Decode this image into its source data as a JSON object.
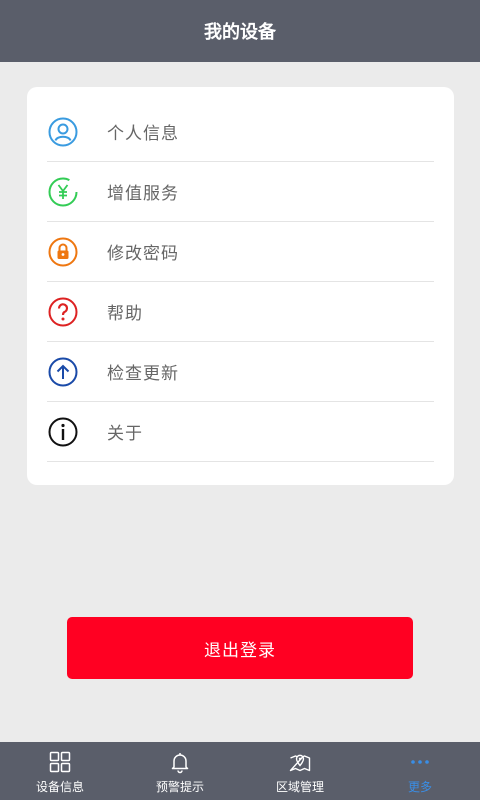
{
  "header": {
    "title": "我的设备"
  },
  "menu": {
    "items": [
      {
        "label": "个人信息",
        "icon": "user-circle-icon",
        "color": "#3a9be0"
      },
      {
        "label": "增值服务",
        "icon": "yen-circle-icon",
        "color": "#33cc55"
      },
      {
        "label": "修改密码",
        "icon": "lock-circle-icon",
        "color": "#ee7711"
      },
      {
        "label": "帮助",
        "icon": "question-circle-icon",
        "color": "#dd2222"
      },
      {
        "label": "检查更新",
        "icon": "arrow-up-circle-icon",
        "color": "#1a4aa8"
      },
      {
        "label": "关于",
        "icon": "info-circle-icon",
        "color": "#111111"
      }
    ]
  },
  "logout": {
    "label": "退出登录"
  },
  "tabbar": {
    "tabs": [
      {
        "label": "设备信息",
        "icon": "grid-icon"
      },
      {
        "label": "预警提示",
        "icon": "bell-icon"
      },
      {
        "label": "区域管理",
        "icon": "map-pin-icon"
      },
      {
        "label": "更多",
        "icon": "more-dots-icon",
        "active": true
      }
    ]
  },
  "colors": {
    "header_bg": "#5a5e6a",
    "logout_bg": "#ff0022",
    "active_tab": "#3a8ee6"
  }
}
